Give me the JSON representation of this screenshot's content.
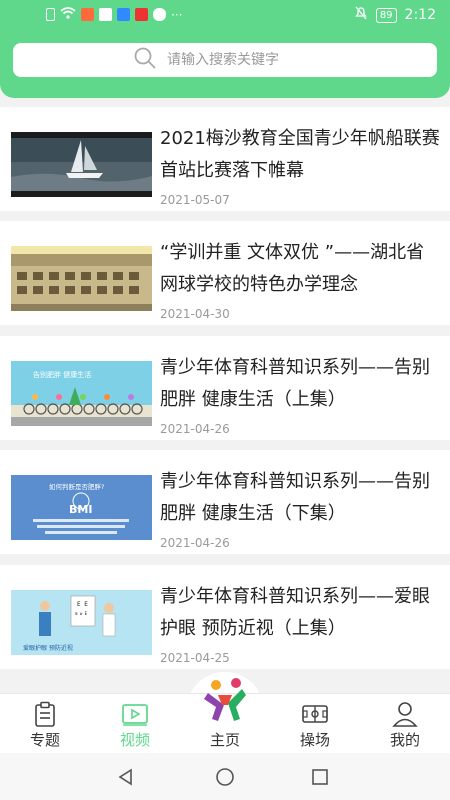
{
  "status": {
    "time": "2:12",
    "battery": "89",
    "dots": "···"
  },
  "search": {
    "placeholder": "请输入搜索关键字"
  },
  "articles": [
    {
      "title": "2021梅沙教育全国青少年帆船联赛首站比赛落下帷幕",
      "date": "2021-05-07"
    },
    {
      "title": "“学训并重 文体双优 ”——湖北省网球学校的特色办学理念",
      "date": "2021-04-30"
    },
    {
      "title": "青少年体育科普知识系列——告别肥胖 健康生活（上集）",
      "date": "2021-04-26"
    },
    {
      "title": "青少年体育科普知识系列——告别肥胖 健康生活（下集）",
      "date": "2021-04-26"
    },
    {
      "title": "青少年体育科普知识系列——爱眼护眼 预防近视（上集）",
      "date": "2021-04-25"
    }
  ],
  "thumb_text": {
    "t3": "告别肥胖 健康生活",
    "t4a": "如何判断是否肥胖?",
    "t4b": "BMI",
    "t5": "爱眼护眼 预防近视"
  },
  "tabs": [
    {
      "label": "专题",
      "icon": "clipboard-icon"
    },
    {
      "label": "视频",
      "icon": "video-icon"
    },
    {
      "label": "主页",
      "icon": "home-logo-icon"
    },
    {
      "label": "操场",
      "icon": "field-icon"
    },
    {
      "label": "我的",
      "icon": "user-icon"
    }
  ],
  "colors": {
    "accent": "#5fd88c",
    "text": "#222222",
    "muted": "#9a9a9a"
  }
}
